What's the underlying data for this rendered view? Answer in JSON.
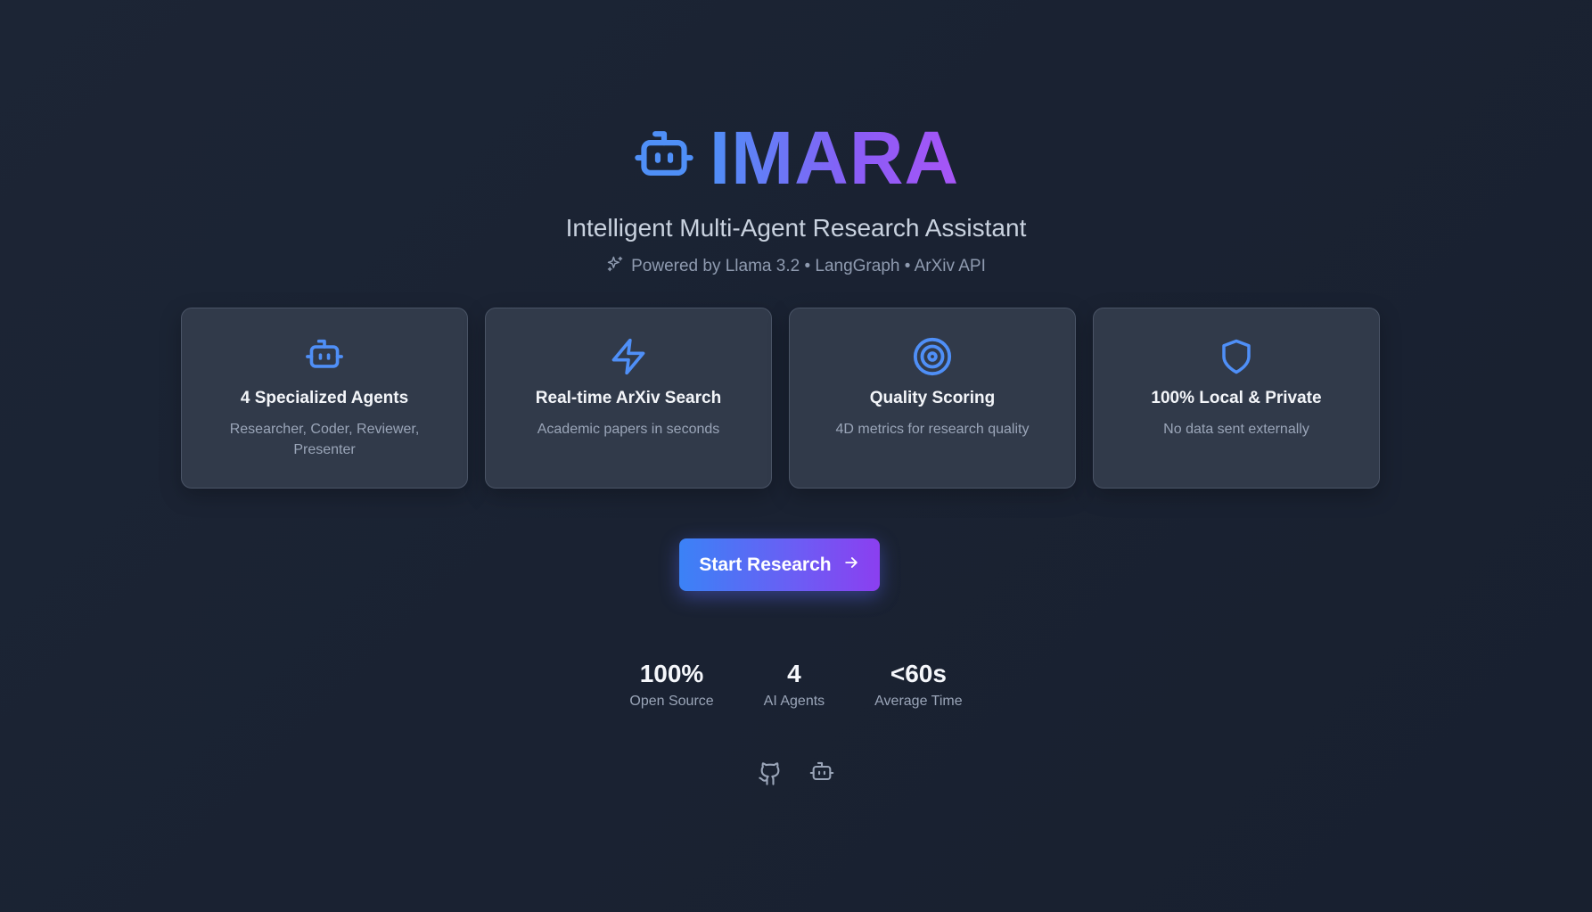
{
  "brand": {
    "name": "IMARA",
    "subtitle": "Intelligent Multi-Agent Research Assistant",
    "powered_by": "Powered by Llama 3.2 • LangGraph • ArXiv API"
  },
  "features": [
    {
      "icon": "robot-icon",
      "title": "4 Specialized Agents",
      "description": "Researcher, Coder, Reviewer, Presenter"
    },
    {
      "icon": "lightning-icon",
      "title": "Real-time ArXiv Search",
      "description": "Academic papers in seconds"
    },
    {
      "icon": "target-icon",
      "title": "Quality Scoring",
      "description": "4D metrics for research quality"
    },
    {
      "icon": "shield-icon",
      "title": "100% Local & Private",
      "description": "No data sent externally"
    }
  ],
  "cta": {
    "label": "Start Research"
  },
  "stats": [
    {
      "value": "100%",
      "label": "Open Source"
    },
    {
      "value": "4",
      "label": "AI Agents"
    },
    {
      "value": "<60s",
      "label": "Average Time"
    }
  ],
  "footer": {
    "icons": [
      "github-icon",
      "robot-icon"
    ]
  },
  "colors": {
    "accent_blue": "#3b82f6",
    "accent_purple": "#8b5cf6",
    "background": "#1c2535",
    "card": "#313a4a"
  }
}
